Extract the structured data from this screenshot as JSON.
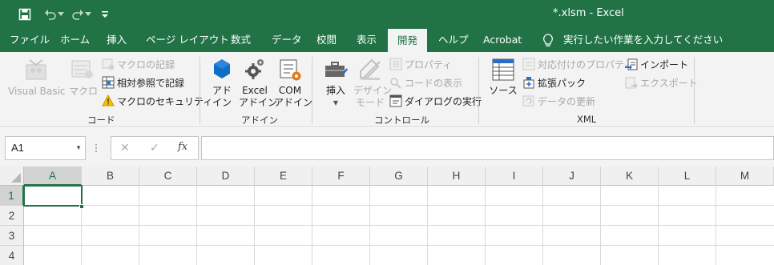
{
  "title": {
    "text": "*.xlsm  -  Excel"
  },
  "tabs": [
    "ファイル",
    "ホーム",
    "挿入",
    "ページ レイアウト",
    "数式",
    "データ",
    "校閲",
    "表示",
    "開発",
    "ヘルプ",
    "Acrobat"
  ],
  "tell_me": "実行したい作業を入力してください",
  "ribbon": {
    "code": {
      "visual_basic": "Visual Basic",
      "macro": "マクロ",
      "record": "マクロの記録",
      "relative": "相対参照で記録",
      "security": "マクロのセキュリティ",
      "label": "コード"
    },
    "addins": {
      "addin_l1": "アド",
      "addin_l2": "イン",
      "excel_l1": "Excel",
      "excel_l2": "アドイン",
      "com_l1": "COM",
      "com_l2": "アドイン",
      "label": "アドイン"
    },
    "controls": {
      "insert": "挿入",
      "design_l1": "デザイン",
      "design_l2": "モード",
      "properties": "プロパティ",
      "view_code": "コードの表示",
      "dialog": "ダイアログの実行",
      "label": "コントロール"
    },
    "xml": {
      "source": "ソース",
      "map_props": "対応付けのプロパティ",
      "expansion": "拡張パック",
      "refresh": "データの更新",
      "import": "インポート",
      "export": "エクスポート",
      "label": "XML"
    }
  },
  "formula_bar": {
    "name_box": "A1",
    "formula": ""
  },
  "columns": [
    "A",
    "B",
    "C",
    "D",
    "E",
    "F",
    "G",
    "H",
    "I",
    "J",
    "K",
    "L",
    "M"
  ],
  "rows": [
    "1",
    "2",
    "3",
    "4"
  ],
  "colors": {
    "accent": "#217346",
    "ribbon_bg": "#f3f3f3"
  }
}
